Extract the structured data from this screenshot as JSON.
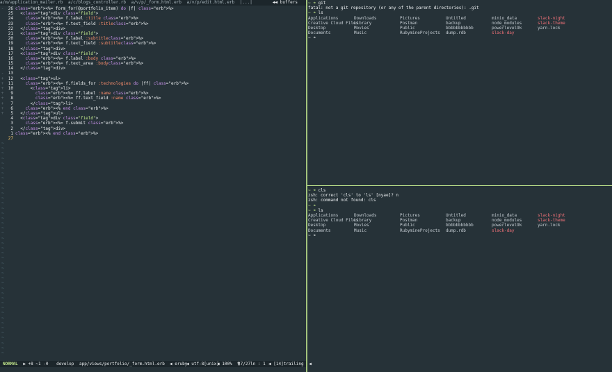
{
  "tabline": {
    "tabs": [
      "a/m/application_mailer.rb",
      "a/c/blogs_controller.rb",
      "a/v/p/_form.html.erb",
      "a/v/p/edit.html.erb",
      "|...|"
    ],
    "buffers_label": "buffers"
  },
  "editor": {
    "lines": [
      {
        "num": "26",
        "text": "<%= form_for(@portfolio_item) do |f| %>"
      },
      {
        "num": "25",
        "text": "  <div class=\"field\">"
      },
      {
        "num": "24",
        "text": "    <%= f.label :title %>"
      },
      {
        "num": "23",
        "text": "    <%= f.text_field :title%>"
      },
      {
        "num": "22",
        "text": "  </div>"
      },
      {
        "num": "21",
        "text": "  <div class=\"field\">"
      },
      {
        "num": "20",
        "text": "    <%= f.label :subtitle%>"
      },
      {
        "num": "19",
        "text": "    <%= f.text_field :subtitle%>"
      },
      {
        "num": "18",
        "text": "  </div>"
      },
      {
        "num": "17",
        "text": "  <div class=\"field\">"
      },
      {
        "num": "16",
        "text": "    <%= f.label :body %>"
      },
      {
        "num": "15",
        "text": "    <%= f.text_area :body%>"
      },
      {
        "num": "14",
        "text": "  </div>"
      },
      {
        "num": "13",
        "text": ""
      },
      {
        "num": "12",
        "text": "  <ul>"
      },
      {
        "num": "11",
        "text": "    <%= f.fields_for :technologies do |ff| %>"
      },
      {
        "num": "10",
        "text": "      <li>"
      },
      {
        "num": "9",
        "text": "        <%= ff.label :name %>"
      },
      {
        "num": "8",
        "text": "        <%= ff.text_field :name %>"
      },
      {
        "num": "7",
        "text": "      </li>"
      },
      {
        "num": "6",
        "text": "    <% end %>"
      },
      {
        "num": "5",
        "text": "  </ul>"
      },
      {
        "num": "4",
        "text": "  <div class=\"field\">"
      },
      {
        "num": "3",
        "text": "    <%= f.submit %>"
      },
      {
        "num": "2",
        "text": "  </div>"
      },
      {
        "num": "1",
        "text": "<% end %>"
      },
      {
        "num": "27",
        "text": ""
      }
    ],
    "gutter_marks": [
      "-",
      "",
      "",
      "",
      "",
      "",
      "",
      "",
      "",
      "",
      "",
      "",
      "",
      "-",
      "+",
      "+",
      "+",
      "+",
      "+",
      "+",
      "+",
      "+",
      "",
      "",
      "",
      "",
      ""
    ]
  },
  "statusline": {
    "mode": "NORMAL",
    "diff": "+8 ~1 -0",
    "branch": "develop",
    "file": "app/views/portfolio/_form.html.erb",
    "filetype": "eruby",
    "encoding": "utf-8[unix]",
    "percent": "100%",
    "position": "27/27ln : 1",
    "trailing": "[14]trailing"
  },
  "term_top": {
    "rows": [
      {
        "prompt": "~ ➜",
        "cmd": "git"
      },
      {
        "output": "fatal: not a git repository (or any of the parent directories): .git"
      },
      {
        "prompt": "~ ➜",
        "cmd": "ls"
      }
    ],
    "ls": [
      "Applications",
      "Downloads",
      "Pictures",
      "Untitled",
      "minio_data",
      "slack-night",
      "Creative Cloud Files",
      "Library",
      "Postman",
      "backup",
      "node_modules",
      "slack-theme",
      "Desktop",
      "Movies",
      "Public",
      "bbbbbbbbbbb",
      "powerlevel9k",
      "yarn.lock",
      "Documents",
      "Music",
      "RubymineProjects",
      "dump.rdb",
      "slack-day",
      ""
    ],
    "end_prompt": "~ ➜"
  },
  "term_bottom": {
    "rows": [
      {
        "prompt": "~ ➜",
        "cmd": "cls"
      },
      {
        "output": "zsh: correct 'cls' to 'ls' [nyae]? n"
      },
      {
        "output": "zsh: command not found: cls"
      },
      {
        "prompt": "~ ➜",
        "cmd": ""
      },
      {
        "prompt": "~ ➜",
        "cmd": "ls"
      }
    ],
    "ls": [
      "Applications",
      "Downloads",
      "Pictures",
      "Untitled",
      "minio_data",
      "slack-night",
      "Creative Cloud Files",
      "Library",
      "Postman",
      "backup",
      "node_modules",
      "slack-theme",
      "Desktop",
      "Movies",
      "Public",
      "bbbbbbbbbbb",
      "powerlevel9k",
      "yarn.lock",
      "Documents",
      "Music",
      "RubymineProjects",
      "dump.rdb",
      "slack-day",
      ""
    ],
    "end_prompt": "~ ➜"
  },
  "colors": {
    "background": "#263238",
    "accent": "#c3e88d",
    "tag": "#f07178",
    "keyword": "#c792ea"
  }
}
